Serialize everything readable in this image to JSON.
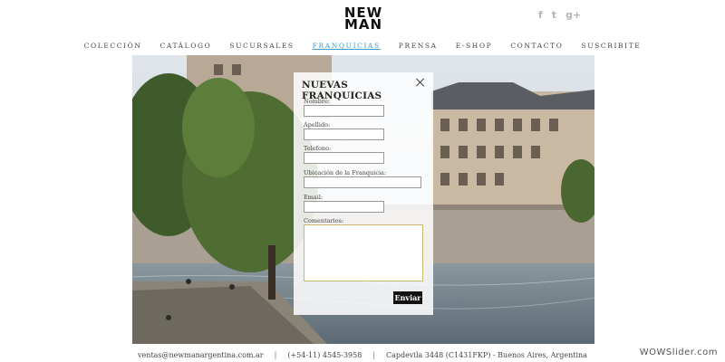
{
  "brand": {
    "logo_top": "NEW",
    "logo_bottom": "MAN"
  },
  "social": [
    "f",
    "t",
    "g+"
  ],
  "nav": {
    "items": [
      {
        "label": "COLECCIÓN"
      },
      {
        "label": "CATÁLOGO"
      },
      {
        "label": "SUCURSALES"
      },
      {
        "label": "FRANQUICIAS",
        "active": true
      },
      {
        "label": "PRENSA"
      },
      {
        "label": "E-SHOP"
      },
      {
        "label": "CONTACTO"
      },
      {
        "label": "SUSCRIBITE"
      }
    ]
  },
  "modal": {
    "title": "NUEVAS FRANQUICIAS",
    "fields": {
      "nombre": {
        "label": "Nombre:",
        "value": ""
      },
      "apellido": {
        "label": "Apellido:",
        "value": ""
      },
      "telefono": {
        "label": "Telefono:",
        "value": ""
      },
      "ubicacion": {
        "label": "Ubicación de la Franquicia:",
        "value": ""
      },
      "email": {
        "label": "Email:",
        "value": ""
      },
      "comentarios": {
        "label": "Comentarios:",
        "value": ""
      }
    },
    "submit_label": "Enviar"
  },
  "footer": {
    "email": "ventas@newmanargentina.com.ar",
    "phone": "(+54-11) 4545-3958",
    "address": "Capdevila 3448 (C1431FKP) - Buenos Aires, Argentina",
    "separator": "|"
  },
  "watermark": "WOWSlider.com"
}
